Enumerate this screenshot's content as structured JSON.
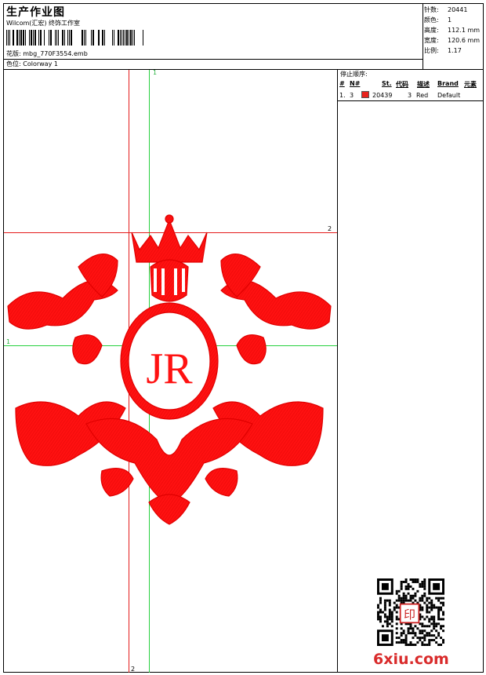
{
  "header": {
    "title": "生产作业图",
    "company": "Wilcom(汇宏) 终饰工作室",
    "design_file_label": "花版:",
    "design_file": "mbg_770F3554.emb",
    "colorway_label": "色位:",
    "colorway": "Colorway 1"
  },
  "stats": [
    {
      "label": "针数:",
      "value": "20441"
    },
    {
      "label": "颜色:",
      "value": "1"
    },
    {
      "label": "高度:",
      "value": "112.1 mm"
    },
    {
      "label": "宽度:",
      "value": "120.6 mm"
    },
    {
      "label": "比例:",
      "value": "1.17"
    }
  ],
  "stop_sequence": {
    "heading": "停止顺序:",
    "columns": [
      "#",
      "N#",
      "St.",
      "代码",
      "描述",
      "Brand",
      "元素"
    ],
    "rows": [
      {
        "index": "1.",
        "needle": "3",
        "stitches": "20439",
        "code": "3",
        "description": "Red",
        "brand": "Default",
        "color": "#e8221c"
      }
    ]
  },
  "guides": {
    "top_label": "1",
    "bottom_label": "2",
    "left_label": "1",
    "right_label": "2"
  },
  "design": {
    "monogram": "JR",
    "thread_color": "#ff1111"
  },
  "watermark": "6xiu.com",
  "qr_stamp": "印"
}
